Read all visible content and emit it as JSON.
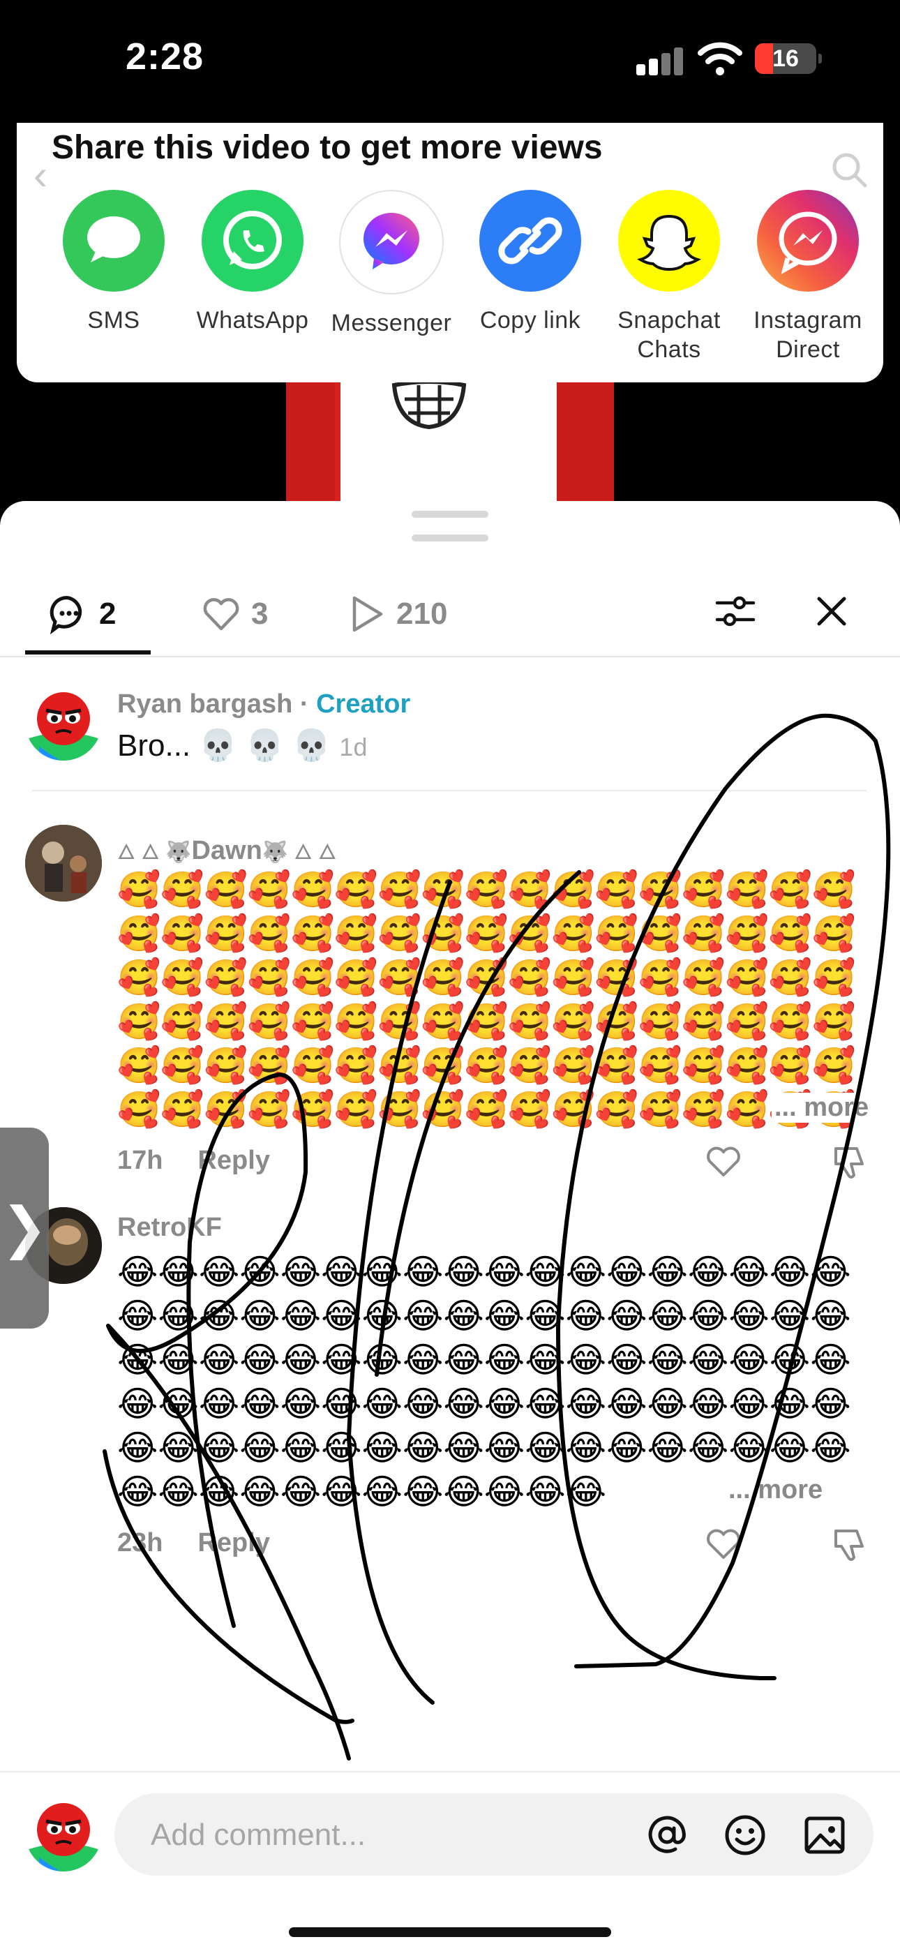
{
  "status_bar": {
    "time": "2:28",
    "battery": "16"
  },
  "share": {
    "title": "Share this video to get more views",
    "items": [
      {
        "label": "SMS",
        "icon": "sms-icon",
        "color": "#34c759"
      },
      {
        "label": "WhatsApp",
        "icon": "whatsapp-icon",
        "color": "#25d366"
      },
      {
        "label": "Messenger",
        "icon": "messenger-icon",
        "color": "#ffffff"
      },
      {
        "label": "Copy link",
        "icon": "link-icon",
        "color": "#2d7df6"
      },
      {
        "label": "Snapchat\nChats",
        "icon": "snapchat-icon",
        "color": "#fffc00"
      },
      {
        "label": "Instagram\nDirect",
        "icon": "instagram-icon",
        "color": "#e1306c"
      }
    ]
  },
  "tabs": {
    "comments": "2",
    "likes": "3",
    "views": "210"
  },
  "comments": [
    {
      "author": "Ryan bargash",
      "sep": " · ",
      "badge": "Creator",
      "text": "Bro... 💀 💀 💀",
      "time": "1d"
    },
    {
      "author": "Dawn",
      "author_prefix": "🜂 🜂 🐺",
      "author_suffix": "🐺 🜂 🜂",
      "emoji": "🥰",
      "emoji_count": 102,
      "more": "... more",
      "time": "17h",
      "reply": "Reply"
    },
    {
      "author": "RetroKF",
      "emoji": "😂",
      "emoji_count": 102,
      "more": "... more",
      "time": "23h",
      "reply": "Reply"
    }
  ],
  "input": {
    "placeholder": "Add comment..."
  },
  "colors": {
    "creator": "#1ea0c3",
    "sms": "#34c759",
    "whatsapp": "#25d366",
    "copy_link": "#2d7df6",
    "snapchat": "#fffc00"
  }
}
